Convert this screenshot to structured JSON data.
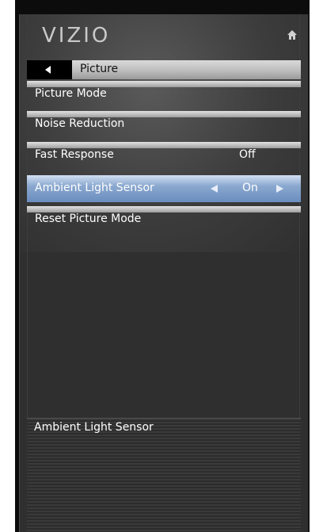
{
  "brand": {
    "logo_text": "VIZIO"
  },
  "header": {
    "home_icon": "home-icon"
  },
  "breadcrumb": {
    "back_icon": "left-arrow-icon",
    "title": "Picture"
  },
  "menu": {
    "items": [
      {
        "label": "Picture Mode",
        "value": ""
      },
      {
        "label": "Noise Reduction",
        "value": ""
      },
      {
        "label": "Fast Response",
        "value": "Off"
      },
      {
        "label": "Ambient Light Sensor",
        "value": "On",
        "selected": true
      },
      {
        "label": "Reset Picture Mode",
        "value": ""
      }
    ]
  },
  "help": {
    "text": "Ambient Light Sensor"
  },
  "colors": {
    "selection": "#7c9ccb",
    "panel": "#2f2f2f",
    "bezel": "#0c0c0c"
  }
}
